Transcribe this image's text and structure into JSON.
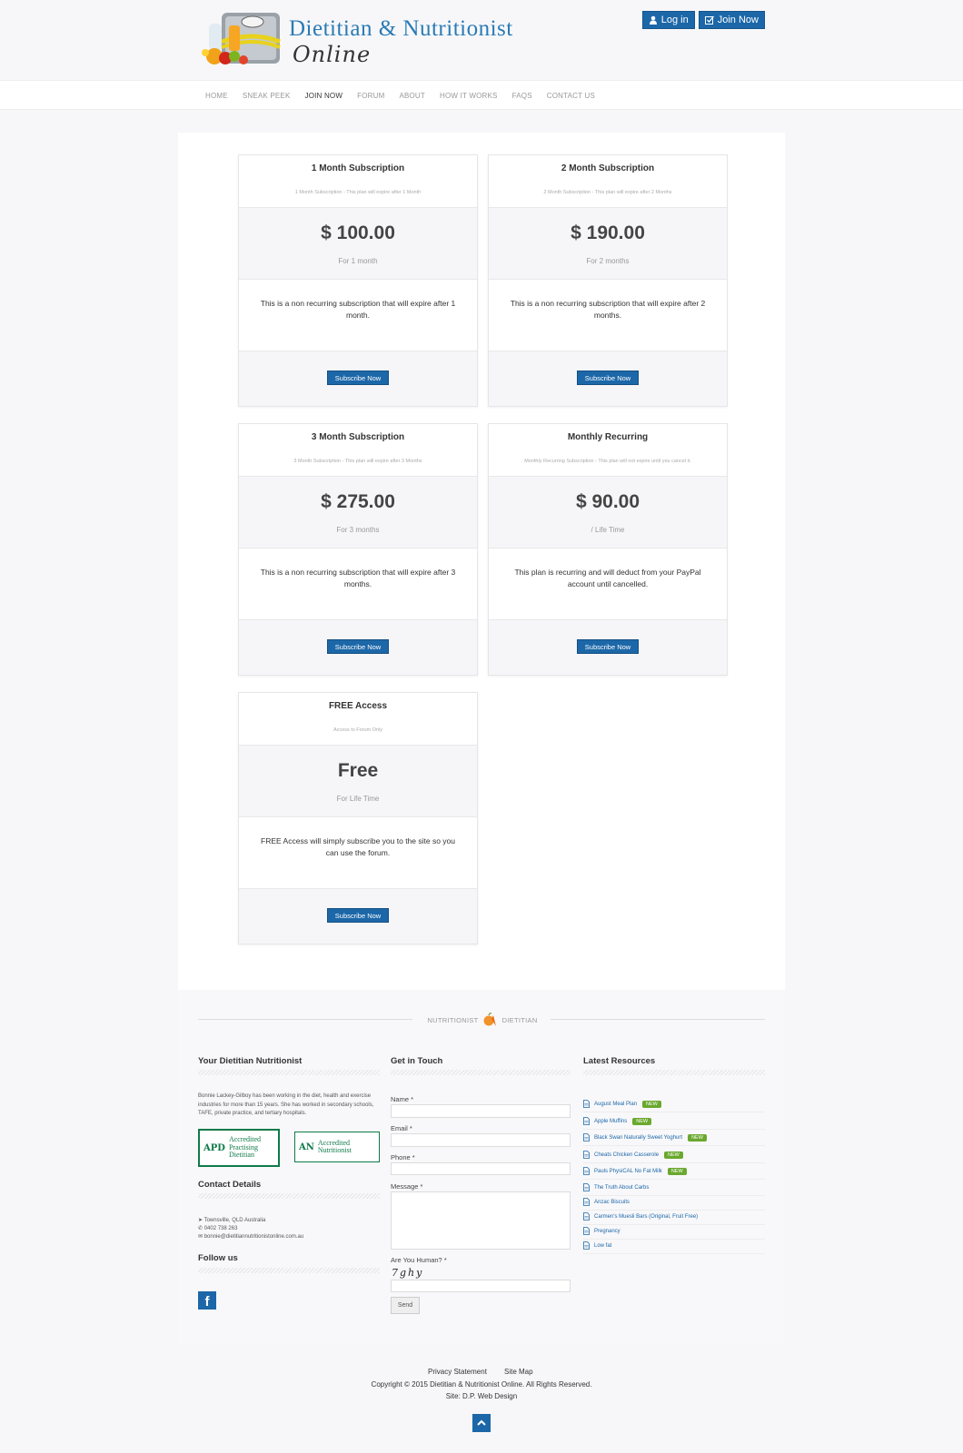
{
  "header": {
    "logo_title": "Dietitian & Nutritionist",
    "logo_sub": "Online",
    "login_label": "Log in",
    "join_label": "Join Now"
  },
  "nav": [
    "HOME",
    "SNEAK PEEK",
    "JOIN NOW",
    "FORUM",
    "ABOUT",
    "HOW IT WORKS",
    "FAQS",
    "CONTACT US"
  ],
  "nav_active": "JOIN NOW",
  "plans": [
    {
      "title": "1 Month Subscription",
      "desc": "1 Month Subscription - This plan will expire after 1 Month",
      "price": "$ 100.00",
      "period": "For  1 month",
      "body": "This is a non recurring subscription that will expire after 1 month.",
      "button": "Subscribe Now"
    },
    {
      "title": "2 Month Subscription",
      "desc": "2 Month Subscription - This plan will expire after 2 Months",
      "price": "$ 190.00",
      "period": "For  2 months",
      "body": "This is a non recurring subscription that will expire after 2 months.",
      "button": "Subscribe Now"
    },
    {
      "title": "3 Month Subscription",
      "desc": "3 Month Subscription - This plan will expire after 3 Months",
      "price": "$ 275.00",
      "period": "For  3 months",
      "body": "This is a non recurring subscription that will expire after 3 months.",
      "button": "Subscribe Now"
    },
    {
      "title": "Monthly Recurring",
      "desc": "Monthly Recurring Subscription - This plan will not expire until you cancel it.",
      "price": "$ 90.00",
      "period": "/  Life Time",
      "body": "This plan is recurring and will deduct from your PayPal account until cancelled.",
      "button": "Subscribe Now"
    },
    {
      "title": "FREE Access",
      "desc": "Access to Forum Only",
      "price": "Free",
      "period": "For  Life Time",
      "body": "FREE Access will simply subscribe you to the site so you can use the forum.",
      "button": "Subscribe Now"
    }
  ],
  "footer": {
    "badge_left": "NUTRITIONIST",
    "badge_right": "DIETITIAN",
    "col1_title": "Your Dietitian Nutritionist",
    "col1_text": "Bonnie Lackey-Gilboy has been working in the diet, health and exercise industries for more than 15 years. She has worked in secondary schools, TAFE, private practice, and tertiary hospitals.",
    "cert1_mark": "APD",
    "cert1_label": "Accredited Practising Dietitian",
    "cert2_mark": "AN",
    "cert2_label": "Accredited Nutritionist",
    "contact_title": "Contact Details",
    "contact_location": "Townsville, QLD Australia",
    "contact_phone": "0402 738 263",
    "contact_email": "bonnie@dietitiannutritionistonline.com.au",
    "follow_title": "Follow us",
    "col2_title": "Get in Touch",
    "label_name": "Name *",
    "label_email": "Email *",
    "label_phone": "Phone *",
    "label_message": "Message *",
    "label_human": "Are You Human? *",
    "captcha": "7ghy",
    "send_label": "Send",
    "col3_title": "Latest Resources",
    "resources": [
      {
        "label": "August Meal Plan",
        "badge": "NEW"
      },
      {
        "label": "Apple Muffins",
        "badge": "NEW"
      },
      {
        "label": "Black Swan Naturally Sweet Yoghurt",
        "badge": "NEW"
      },
      {
        "label": "Cheats Chicken Casserole",
        "badge": "NEW"
      },
      {
        "label": "Pauls PhysiCAL No Fat Milk",
        "badge": "NEW"
      },
      {
        "label": "The Truth About Carbs",
        "badge": ""
      },
      {
        "label": "Anzac Biscuits",
        "badge": ""
      },
      {
        "label": "Carmen's Muesli Bars (Original, Fruit Free)",
        "badge": ""
      },
      {
        "label": "Pregnancy",
        "badge": ""
      },
      {
        "label": "Low fat",
        "badge": ""
      }
    ]
  },
  "bottom": {
    "privacy": "Privacy Statement",
    "sitemap": "Site Map",
    "copyright": "Copyright © 2015 Dietitian & Nutritionist Online. All Rights Reserved.",
    "site": "Site: D.P. Web Design"
  },
  "colors": {
    "accent": "#1c67a8",
    "new_badge": "#6aa82e",
    "cert_green": "#0f7a49"
  }
}
